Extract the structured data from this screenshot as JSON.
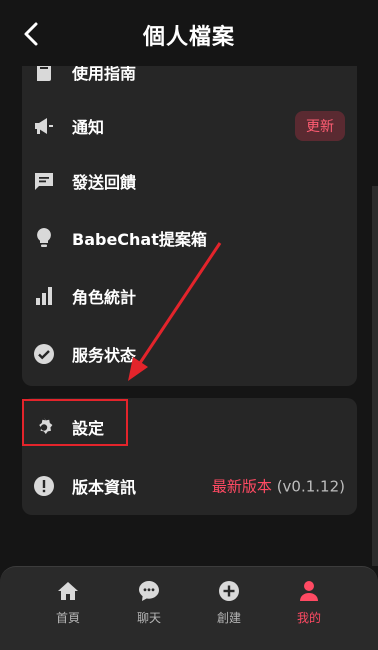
{
  "header": {
    "title": "個人檔案"
  },
  "menu": {
    "guide_label": "使用指南",
    "notify_label": "通知",
    "notify_badge": "更新",
    "feedback_label": "發送回饋",
    "suggest_label": "BabeChat提案箱",
    "stats_label": "角色統計",
    "status_label": "服务状态",
    "settings_label": "設定",
    "version_label": "版本資訊",
    "version_latest": "最新版本",
    "version_number": "(v0.1.12)"
  },
  "tabs": [
    {
      "label": "首頁",
      "icon": "home-icon"
    },
    {
      "label": "聊天",
      "icon": "chat-icon"
    },
    {
      "label": "創建",
      "icon": "plus-circle-icon"
    },
    {
      "label": "我的",
      "icon": "person-icon"
    }
  ],
  "colors": {
    "accent": "#ff4a63",
    "badge_bg": "#5a2a31",
    "card_bg": "#262626",
    "background": "#151515",
    "annotation": "#e3242b"
  }
}
